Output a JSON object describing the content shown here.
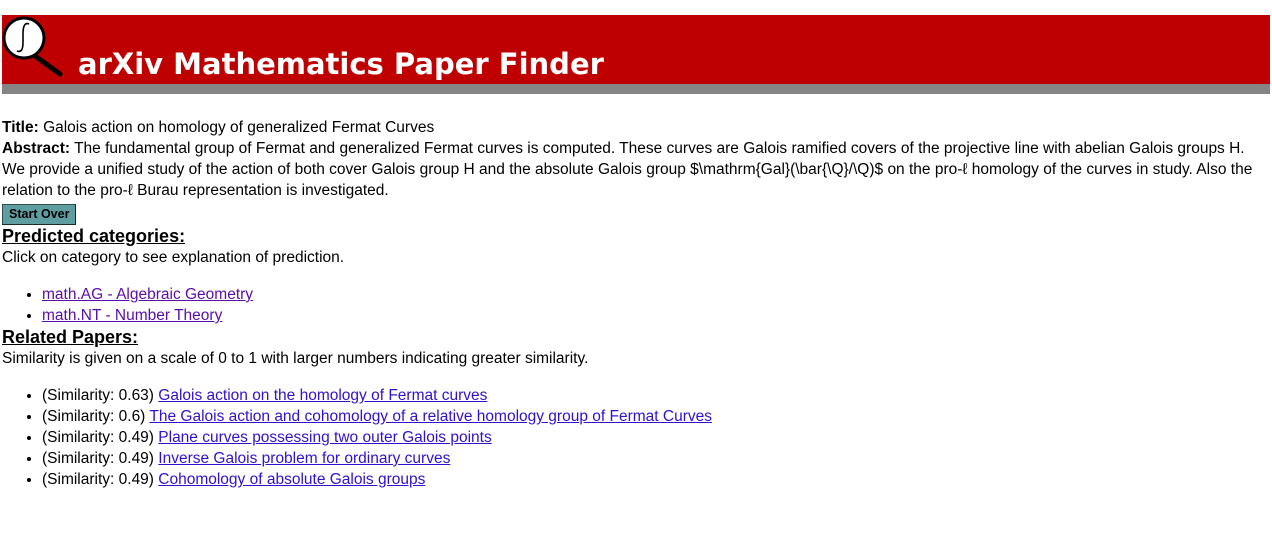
{
  "header": {
    "title": "arXiv Mathematics Paper Finder",
    "logo_icon": "integral-magnifier-icon",
    "background_color": "#bf0000",
    "bar_color": "#858585"
  },
  "paper": {
    "title_label": "Title:",
    "title": "Galois action on homology of generalized Fermat Curves",
    "abstract_label": "Abstract:",
    "abstract": "The fundamental group of Fermat and generalized Fermat curves is computed. These curves are Galois ramified covers of the projective line with abelian Galois groups H. We provide a unified study of the action of both cover Galois group H and the absolute Galois group $\\mathrm{Gal}(\\bar{\\Q}/\\Q)$ on the pro-ℓ homology of the curves in study. Also the relation to the pro-ℓ Burau representation is investigated.",
    "start_over_label": "Start Over",
    "start_over_color": "#5f9ea0"
  },
  "categories": {
    "heading": "Predicted categories:",
    "note": "Click on category to see explanation of prediction.",
    "items": [
      {
        "label": "math.AG - Algebraic Geometry"
      },
      {
        "label": "math.NT - Number Theory"
      }
    ]
  },
  "related": {
    "heading": "Related Papers:",
    "note": "Similarity is given on a scale of 0 to 1 with larger numbers indicating greater similarity.",
    "items": [
      {
        "similarity": "(Similarity: 0.63)",
        "title": "Galois action on the homology of Fermat curves"
      },
      {
        "similarity": "(Similarity: 0.6)",
        "title": "The Galois action and cohomology of a relative homology group of Fermat Curves"
      },
      {
        "similarity": "(Similarity: 0.49)",
        "title": "Plane curves possessing two outer Galois points"
      },
      {
        "similarity": "(Similarity: 0.49)",
        "title": "Inverse Galois problem for ordinary curves"
      },
      {
        "similarity": "(Similarity: 0.49)",
        "title": "Cohomology of absolute Galois groups"
      }
    ]
  }
}
